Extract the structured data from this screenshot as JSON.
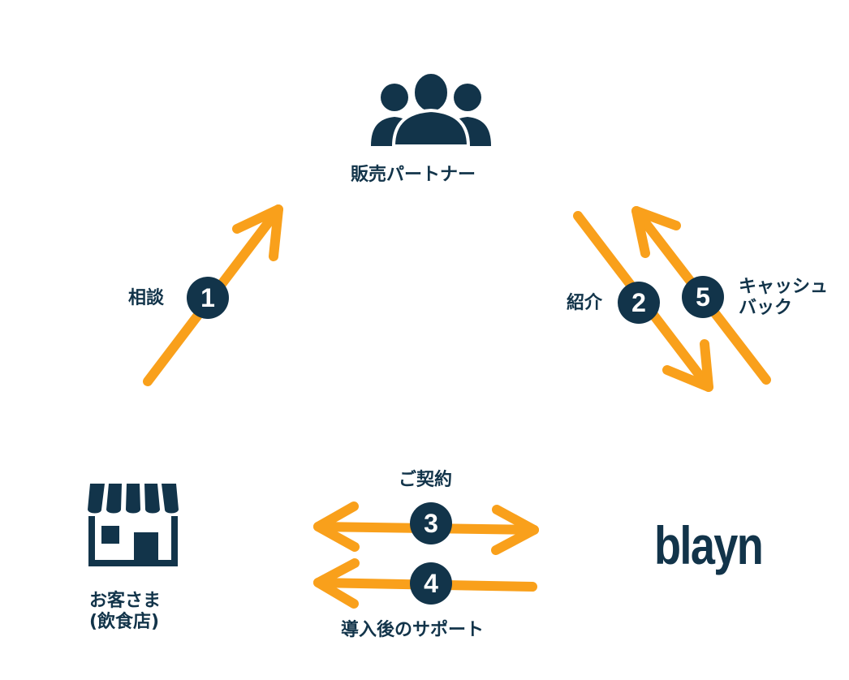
{
  "nodes": {
    "partner_label": "販売パートナー",
    "customer_label_line1": "お客さま",
    "customer_label_line2": "(飲食店)",
    "brand_logo_text": "blayn"
  },
  "steps": [
    {
      "number": "1",
      "label": "相談"
    },
    {
      "number": "2",
      "label": "紹介"
    },
    {
      "number": "3",
      "label": "ご契約"
    },
    {
      "number": "4",
      "label": "導入後のサポート"
    },
    {
      "number": "5",
      "label_line1": "キャッシュ",
      "label_line2": "バック"
    }
  ],
  "icons": {
    "partner": "people-group-icon",
    "customer": "storefront-icon"
  },
  "colors": {
    "arrow": "#f9a01b",
    "navy": "#12344a",
    "background": "#ffffff"
  }
}
